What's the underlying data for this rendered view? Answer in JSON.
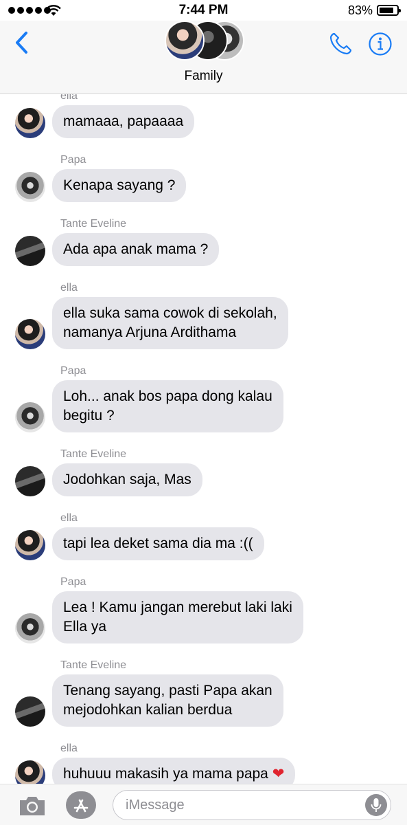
{
  "status": {
    "time": "7:44 PM",
    "battery_pct": "83%",
    "battery_level": 0.83
  },
  "header": {
    "group_name": "Family"
  },
  "messages": [
    {
      "sender": "ella",
      "text_lines": [
        "mamaaa, papaaaa"
      ],
      "avatar": "ella"
    },
    {
      "sender": "Papa",
      "text_lines": [
        "Kenapa sayang ?"
      ],
      "avatar": "papa"
    },
    {
      "sender": "Tante Eveline",
      "text_lines": [
        "Ada apa anak mama ?"
      ],
      "avatar": "tante"
    },
    {
      "sender": "ella",
      "text_lines": [
        "ella suka sama cowok di sekolah,",
        "namanya Arjuna Ardithama"
      ],
      "avatar": "ella"
    },
    {
      "sender": "Papa",
      "text_lines": [
        "Loh... anak bos papa dong kalau",
        "begitu ?"
      ],
      "avatar": "papa"
    },
    {
      "sender": "Tante Eveline",
      "text_lines": [
        "Jodohkan saja, Mas"
      ],
      "avatar": "tante"
    },
    {
      "sender": "ella",
      "text_lines": [
        "tapi lea deket sama dia ma :(("
      ],
      "avatar": "ella"
    },
    {
      "sender": "Papa",
      "text_lines": [
        "Lea ! Kamu jangan merebut laki laki",
        "Ella ya"
      ],
      "avatar": "papa"
    },
    {
      "sender": "Tante Eveline",
      "text_lines": [
        "Tenang sayang, pasti Papa akan",
        "mejodohkan kalian berdua"
      ],
      "avatar": "tante"
    },
    {
      "sender": "ella",
      "text_lines": [
        "huhuuu makasih ya mama papa"
      ],
      "avatar": "ella",
      "emoji": "❤",
      "emoji_name": "red-heart"
    }
  ],
  "input": {
    "placeholder": "iMessage"
  },
  "colors": {
    "accent": "#1a7cf5",
    "bubble_incoming": "#e5e5ea",
    "sender_label": "#8e8e93",
    "heart": "#e0242f"
  },
  "icons": {
    "back": "chevron-left-icon",
    "call": "phone-icon",
    "info": "info-icon",
    "camera": "camera-icon",
    "apps": "app-store-icon",
    "mic": "microphone-icon"
  }
}
